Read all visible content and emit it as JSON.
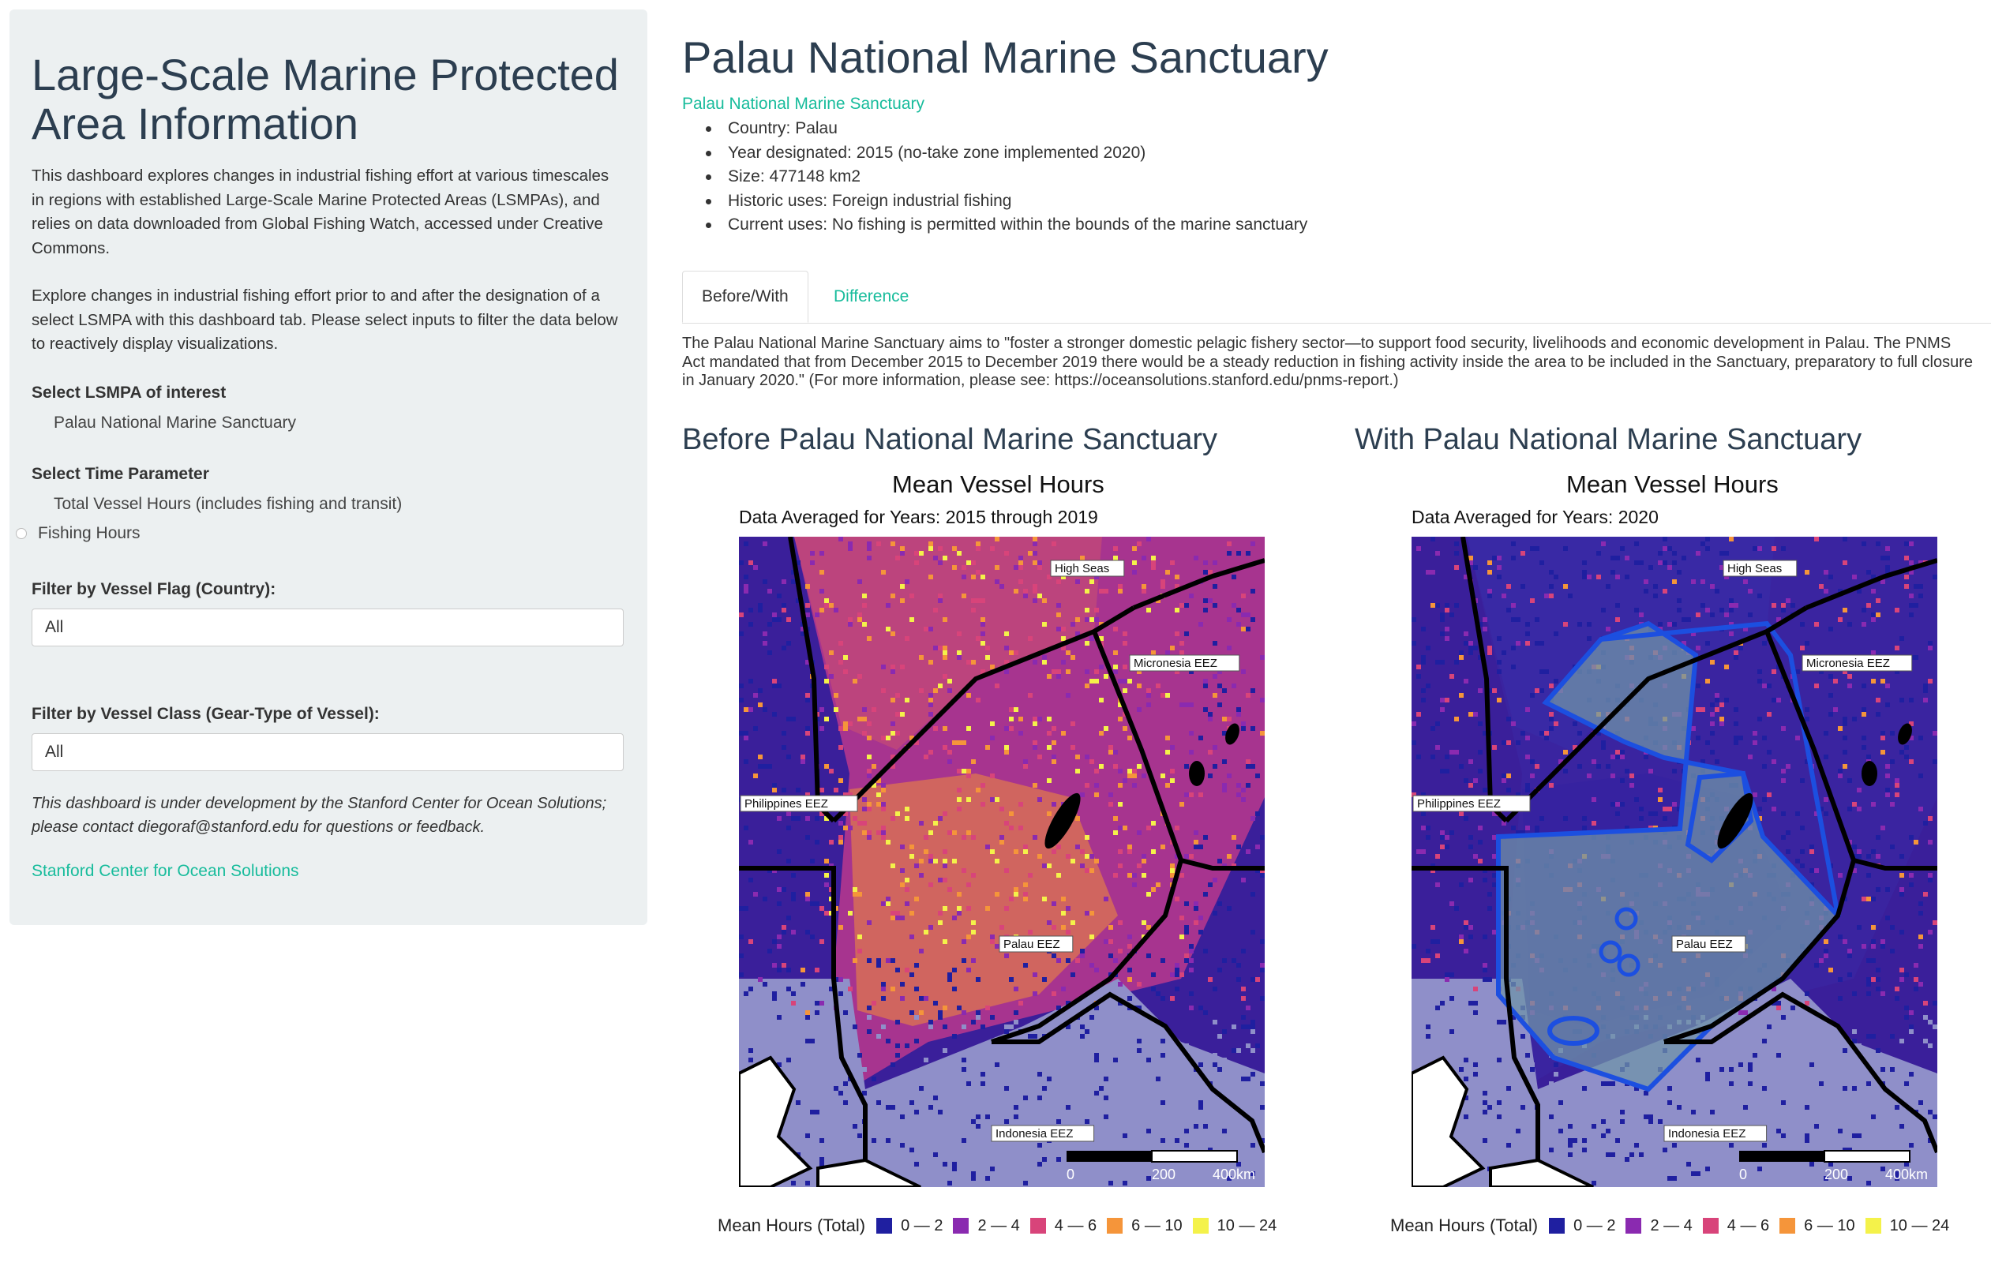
{
  "sidebar": {
    "title": "Large-Scale Marine Protected Area Information",
    "intro": "This dashboard explores changes in industrial fishing effort at various timescales in regions with established Large-Scale Marine Protected Areas (LSMPAs), and relies on data downloaded from Global Fishing Watch, accessed under Creative Commons.",
    "instructions": "Explore changes in industrial fishing effort prior to and after the designation of a select LSMPA with this dashboard tab. Please select inputs to filter the data below to reactively display visualizations.",
    "lsmpa_label": "Select LSMPA of interest",
    "lsmpa_options": [
      "Palau National Marine Sanctuary"
    ],
    "time_label": "Select Time Parameter",
    "time_options": [
      "Total Vessel Hours (includes fishing and transit)",
      "Fishing Hours"
    ],
    "flag_label": "Filter by Vessel Flag (Country):",
    "flag_value": "All",
    "class_label": "Filter by Vessel Class (Gear-Type of Vessel):",
    "class_value": "All",
    "note": "This dashboard is under development by the Stanford Center for Ocean Solutions; please contact diegoraf@stanford.edu for questions or feedback.",
    "footer_link": "Stanford Center for Ocean Solutions"
  },
  "main": {
    "title": "Palau National Marine Sanctuary",
    "link": "Palau National Marine Sanctuary",
    "facts": [
      "Country: Palau",
      "Year designated: 2015 (no-take zone implemented 2020)",
      "Size: 477148 km2",
      "Historic uses: Foreign industrial fishing",
      "Current uses: No fishing is permitted within the bounds of the marine sanctuary"
    ],
    "tabs": [
      "Before/With",
      "Difference"
    ],
    "description": "The Palau National Marine Sanctuary aims to \"foster a stronger domestic pelagic fishery sector—to support food security, livelihoods and economic development in Palau. The PNMS Act mandated that from December 2015 to December 2019 there would be a steady reduction in fishing activity inside the area to be included in the Sanctuary, preparatory to full closure in January 2020.\" (For more information, please see: https://oceansolutions.stanford.edu/pnms-report.)",
    "panels": [
      {
        "section_title": "Before Palau National Marine Sanctuary",
        "map_title": "Mean Vessel Hours",
        "map_subtitle": "Data Averaged for Years: 2015 through 2019",
        "show_sanctuary_boundary": false
      },
      {
        "section_title": "With Palau National Marine Sanctuary",
        "map_title": "Mean Vessel Hours",
        "map_subtitle": "Data Averaged for Years: 2020",
        "show_sanctuary_boundary": true
      }
    ],
    "map_labels": {
      "high_seas": "High Seas",
      "micronesia": "Micronesia EEZ",
      "philippines": "Philippines EEZ",
      "palau": "Palau EEZ",
      "indonesia": "Indonesia EEZ"
    },
    "scale_bar": [
      "0",
      "200",
      "400km"
    ],
    "legend": {
      "title": "Mean Hours (Total)",
      "items": [
        {
          "label": "0 — 2",
          "color": "#1f1fa0"
        },
        {
          "label": "2 — 4",
          "color": "#8a2ab0"
        },
        {
          "label": "4 — 6",
          "color": "#d8447a"
        },
        {
          "label": "6 — 10",
          "color": "#f5953a"
        },
        {
          "label": "10 — 24",
          "color": "#f4f24a"
        }
      ]
    }
  }
}
